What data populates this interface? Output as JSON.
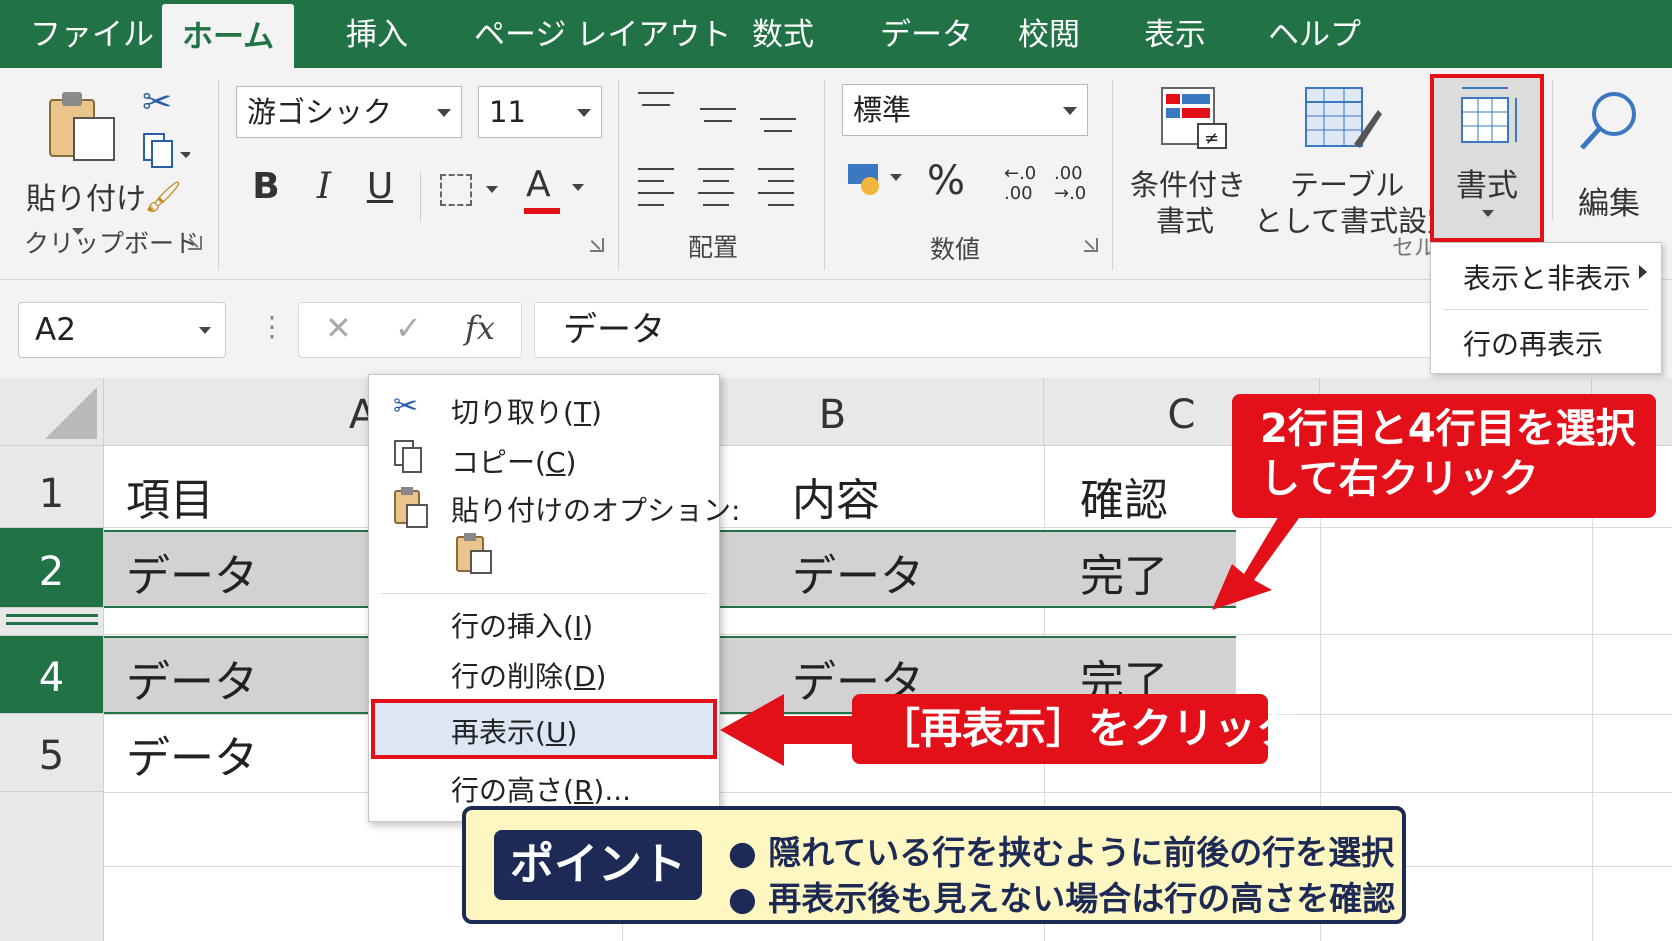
{
  "tabs": [
    {
      "label": "ファイル",
      "active": false
    },
    {
      "label": "ホーム",
      "active": true
    },
    {
      "label": "挿入",
      "active": false
    },
    {
      "label": "ページ レイアウト",
      "active": false
    },
    {
      "label": "数式",
      "active": false
    },
    {
      "label": "データ",
      "active": false
    },
    {
      "label": "校閲",
      "active": false
    },
    {
      "label": "表示",
      "active": false
    },
    {
      "label": "ヘルプ",
      "active": false
    }
  ],
  "clipboard": {
    "paste": "貼り付け",
    "group": "クリップボード"
  },
  "font": {
    "name": "游ゴシック",
    "size": "11",
    "bold": "B",
    "italic": "I",
    "underline": "U",
    "color_letter": "A",
    "color": "#e3101a"
  },
  "alignment": {
    "group": "配置"
  },
  "number": {
    "format": "標準",
    "percent": "%",
    "inc": "←.0 .00",
    "dec": ".00 →.0",
    "group": "数値"
  },
  "styles": {
    "conditional_1": "条件付き",
    "conditional_2": "書式",
    "table_1": "テーブル",
    "table_2": "として書式設定",
    "cells_group": "セル"
  },
  "format_button": "書式",
  "edit_button": "編集",
  "format_menu": {
    "item1": "表示と非表示",
    "item2": "行の再表示"
  },
  "namebox": "A2",
  "fx_label": "fx",
  "formula": "データ",
  "columns": [
    "A",
    "B",
    "C"
  ],
  "rows": [
    {
      "num": "1",
      "a": "項目",
      "b": "内容",
      "c": "確認",
      "selected": false
    },
    {
      "num": "2",
      "a": "データ",
      "b": "データ",
      "c": "完了",
      "selected": true
    },
    {
      "num": "4",
      "a": "データ",
      "b": "データ",
      "c": "完了",
      "selected": true
    },
    {
      "num": "5",
      "a": "データ",
      "b": "",
      "c": "",
      "selected": false
    }
  ],
  "context_menu": {
    "cut": [
      "切り取り(",
      "T",
      ")"
    ],
    "copy": [
      "コピー(",
      "C",
      ")"
    ],
    "paste_options": "貼り付けのオプション:",
    "insert": [
      "行の挿入(",
      "I",
      ")"
    ],
    "delete": [
      "行の削除(",
      "D",
      ")"
    ],
    "unhide": [
      "再表示(",
      "U",
      ")"
    ],
    "height": [
      "行の高さ(",
      "R",
      ")..."
    ]
  },
  "callout_select": {
    "line1": "2行目と4行目を選択",
    "line2": "して右クリック"
  },
  "callout_click": "［再表示］をクリック",
  "point": {
    "badge": "ポイント",
    "line1": "● 隠れている行を挟むように前後の行を選択",
    "line2": "● 再表示後も見えない場合は行の高さを確認"
  },
  "colors": {
    "excel_green": "#217346",
    "highlight_red": "#e3101a",
    "point_navy": "#1c2a55",
    "point_bg": "#fff7c2"
  }
}
